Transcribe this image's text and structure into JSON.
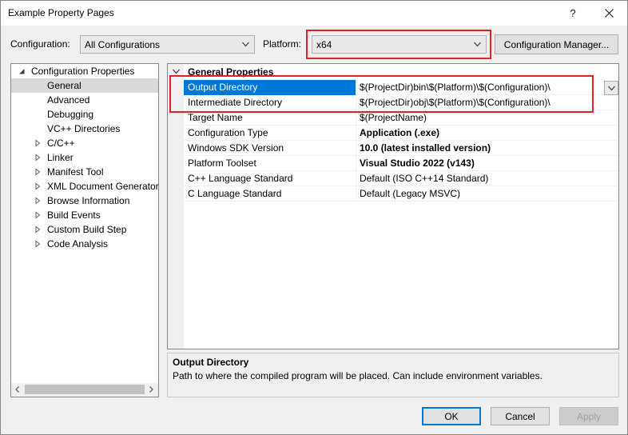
{
  "window": {
    "title": "Example Property Pages",
    "help_glyph": "?"
  },
  "configuration": {
    "label": "Configuration:",
    "value": "All Configurations"
  },
  "platform": {
    "label": "Platform:",
    "value": "x64"
  },
  "config_manager_label": "Configuration Manager...",
  "tree": {
    "items": [
      {
        "label": "Configuration Properties",
        "level": 0,
        "state": "expanded"
      },
      {
        "label": "General",
        "level": 1,
        "state": "none",
        "selected": true
      },
      {
        "label": "Advanced",
        "level": 1,
        "state": "none"
      },
      {
        "label": "Debugging",
        "level": 1,
        "state": "none"
      },
      {
        "label": "VC++ Directories",
        "level": 1,
        "state": "none"
      },
      {
        "label": "C/C++",
        "level": 1,
        "state": "collapsed"
      },
      {
        "label": "Linker",
        "level": 1,
        "state": "collapsed"
      },
      {
        "label": "Manifest Tool",
        "level": 1,
        "state": "collapsed"
      },
      {
        "label": "XML Document Generator",
        "level": 1,
        "state": "collapsed"
      },
      {
        "label": "Browse Information",
        "level": 1,
        "state": "collapsed"
      },
      {
        "label": "Build Events",
        "level": 1,
        "state": "collapsed"
      },
      {
        "label": "Custom Build Step",
        "level": 1,
        "state": "collapsed"
      },
      {
        "label": "Code Analysis",
        "level": 1,
        "state": "collapsed"
      }
    ]
  },
  "grid": {
    "category": "General Properties",
    "rows": [
      {
        "name": "Output Directory",
        "value": "$(ProjectDir)bin\\$(Platform)\\$(Configuration)\\",
        "bold": false,
        "selected": true
      },
      {
        "name": "Intermediate Directory",
        "value": "$(ProjectDir)obj\\$(Platform)\\$(Configuration)\\",
        "bold": false,
        "selected": false
      },
      {
        "name": "Target Name",
        "value": "$(ProjectName)",
        "bold": false,
        "selected": false
      },
      {
        "name": "Configuration Type",
        "value": "Application (.exe)",
        "bold": true,
        "selected": false
      },
      {
        "name": "Windows SDK Version",
        "value": "10.0 (latest installed version)",
        "bold": true,
        "selected": false
      },
      {
        "name": "Platform Toolset",
        "value": "Visual Studio 2022 (v143)",
        "bold": true,
        "selected": false
      },
      {
        "name": "C++ Language Standard",
        "value": "Default (ISO C++14 Standard)",
        "bold": false,
        "selected": false
      },
      {
        "name": "C Language Standard",
        "value": "Default (Legacy MSVC)",
        "bold": false,
        "selected": false
      }
    ]
  },
  "description": {
    "title": "Output Directory",
    "text": "Path to where the compiled program will be placed. Can include environment variables."
  },
  "buttons": {
    "ok": "OK",
    "cancel": "Cancel",
    "apply": "Apply"
  },
  "colors": {
    "selection": "#0078d7",
    "highlight_box": "#e0202a",
    "tree_selection": "#d9d9d9"
  }
}
